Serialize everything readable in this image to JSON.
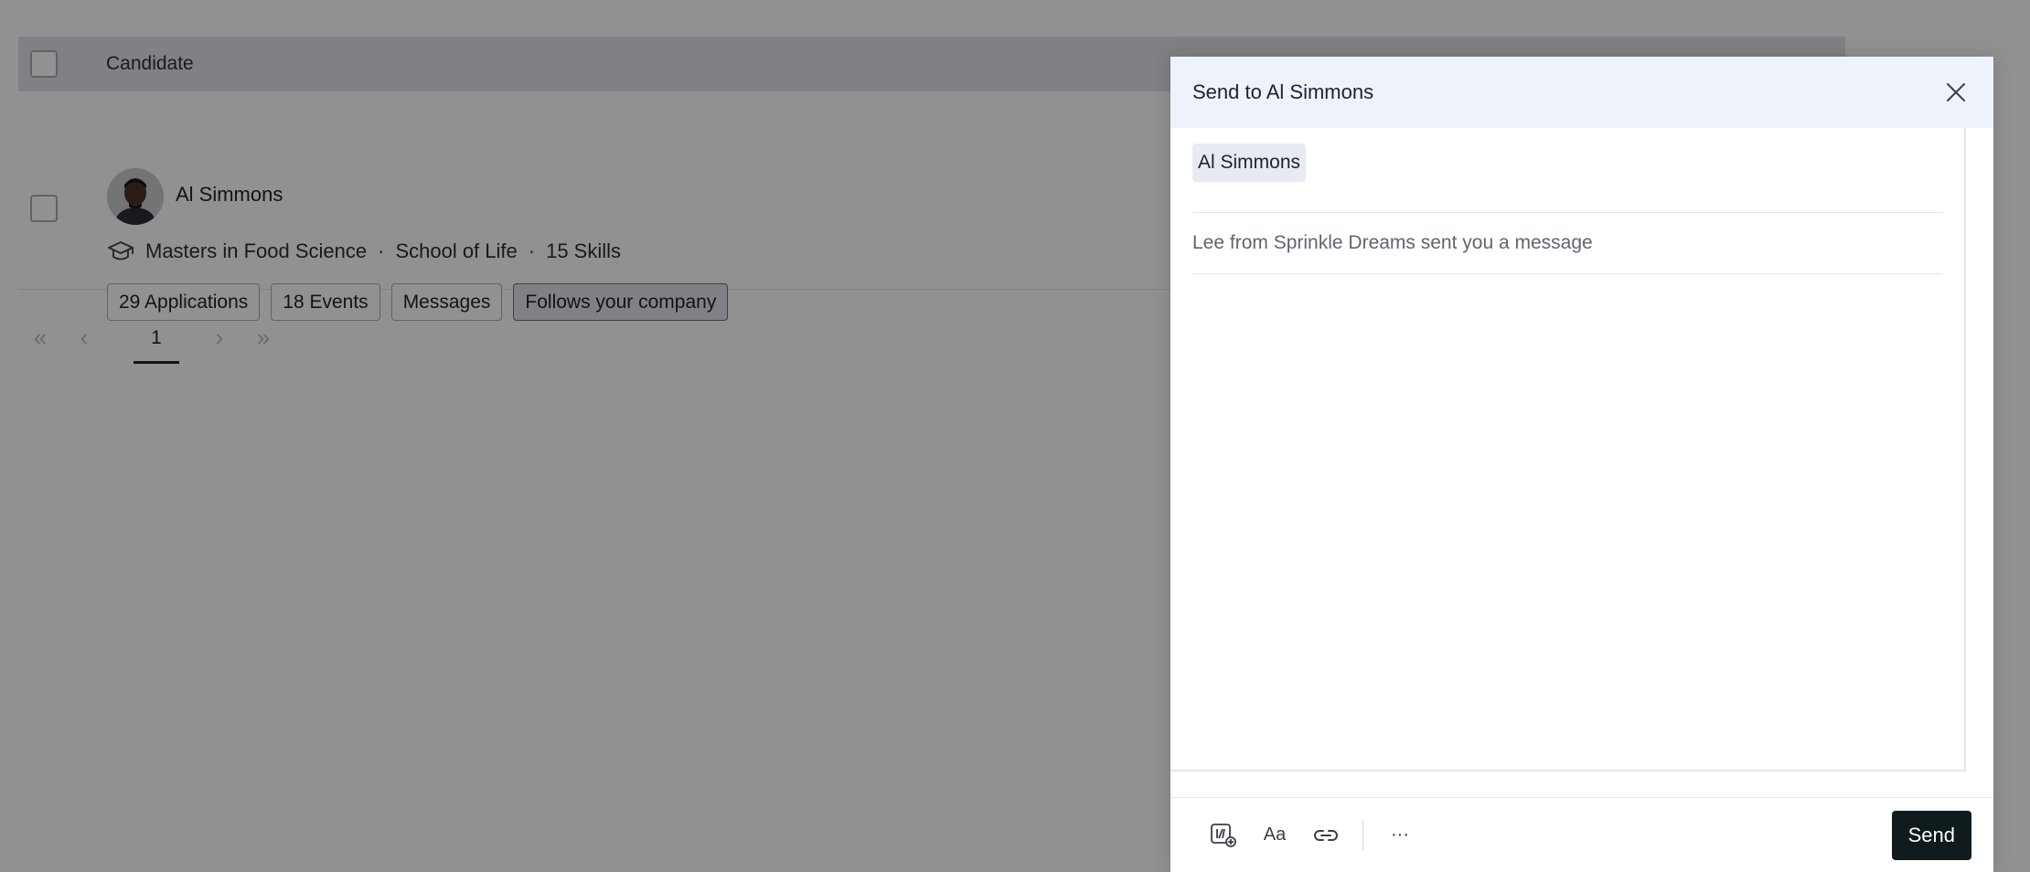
{
  "table": {
    "header_label": "Candidate",
    "candidate": {
      "name": "Al Simmons",
      "degree": "Masters in Food Science",
      "school": "School of Life",
      "skills": "15 Skills",
      "separator": "·",
      "tags": [
        {
          "label": "29 Applications",
          "active": false
        },
        {
          "label": "18 Events",
          "active": false
        },
        {
          "label": "Messages",
          "active": false
        },
        {
          "label": "Follows your company",
          "active": true
        }
      ]
    },
    "pagination": {
      "first": "«",
      "prev": "‹",
      "current_page": "1",
      "next": "›",
      "last": "»"
    }
  },
  "modal": {
    "title": "Send to Al Simmons",
    "recipient_chip": "Al Simmons",
    "subject_value": "Lee from Sprinkle Dreams sent you a message",
    "toolbar": {
      "format_label": "Aa",
      "more_label": "···"
    },
    "send_label": "Send"
  },
  "colors": {
    "overlay": "rgba(0,0,0,0.43)",
    "modal_header_bg": "#eef2fb",
    "send_button_bg": "#0f1b1c",
    "tag_active_bg": "#dfe3ea"
  },
  "icons": {
    "close": "close-icon",
    "graduation": "graduation-cap-icon",
    "template": "template-add-icon",
    "link": "link-icon"
  }
}
